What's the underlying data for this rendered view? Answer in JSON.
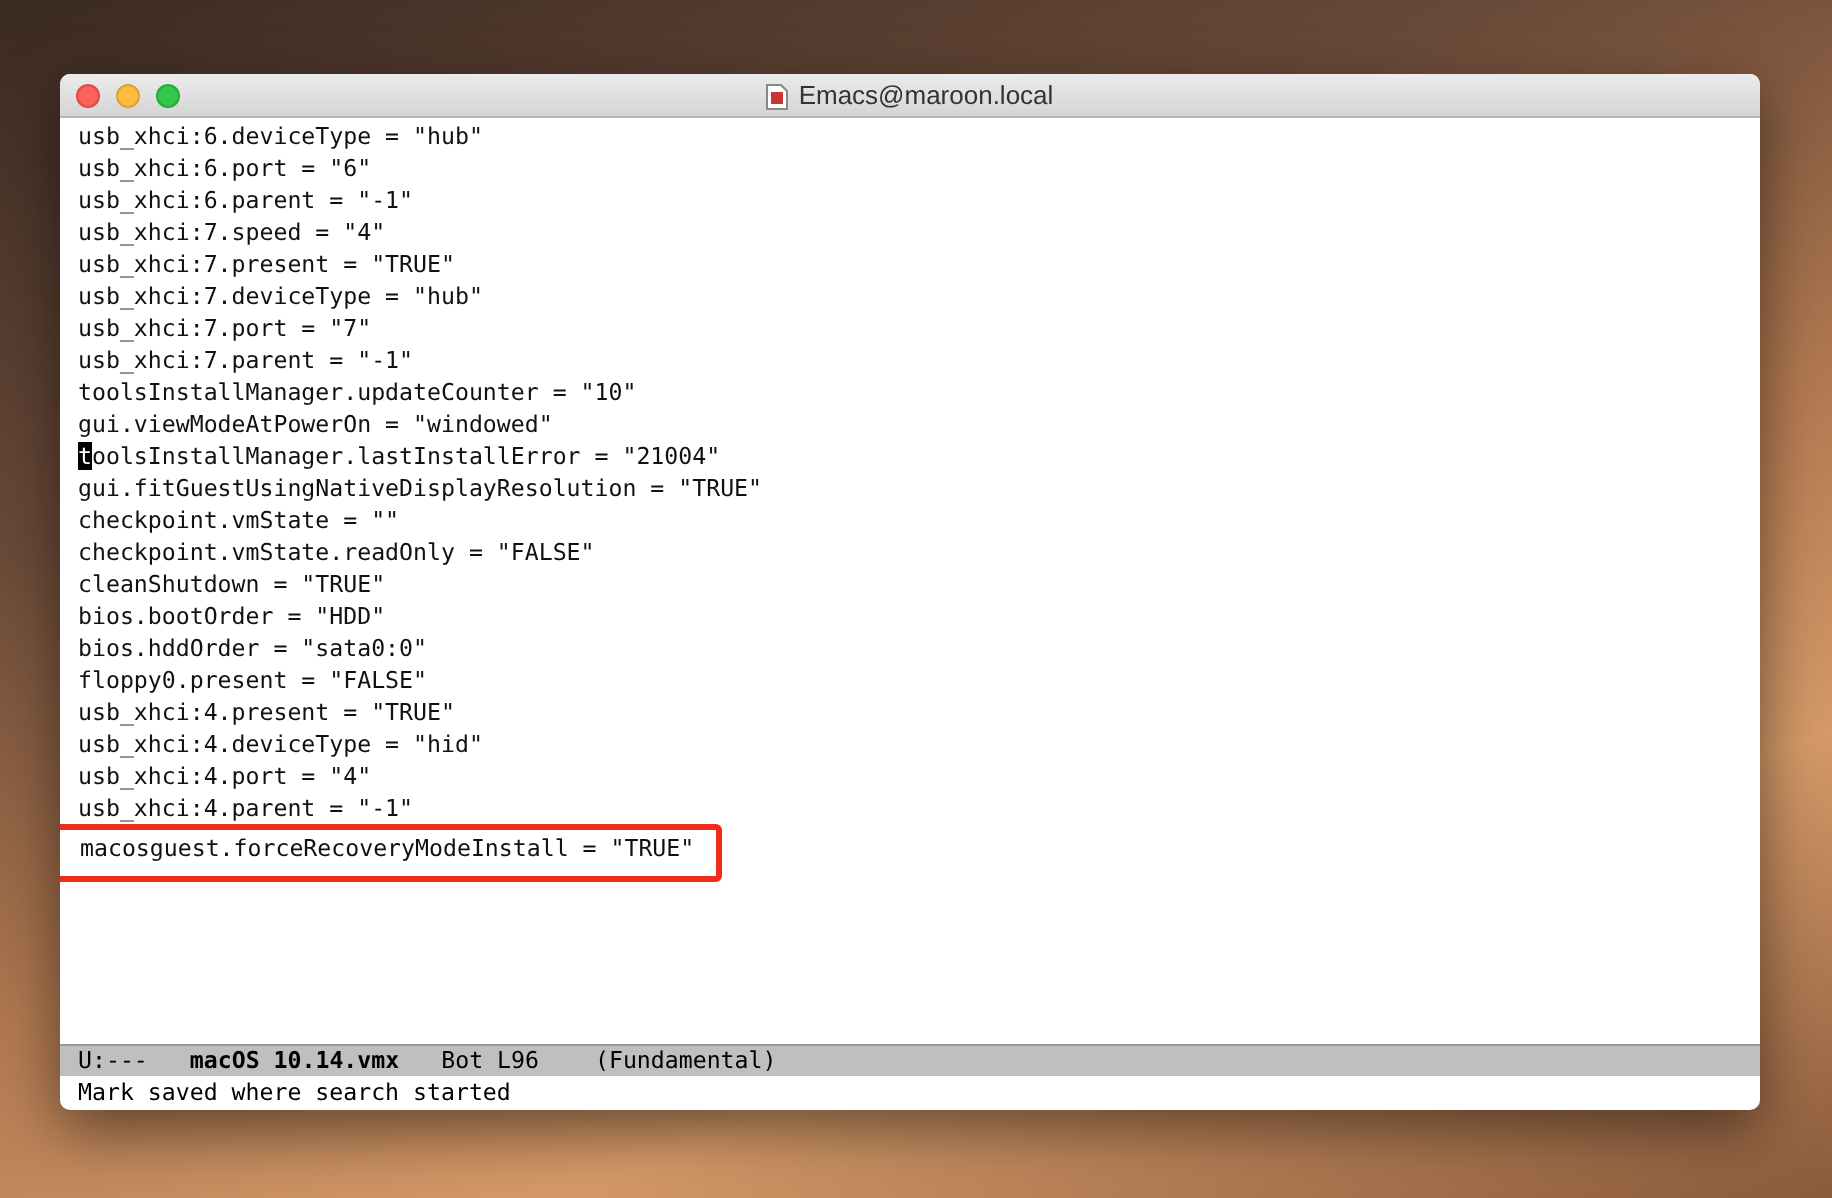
{
  "window": {
    "title": "Emacs@maroon.local"
  },
  "buffer": {
    "lines": [
      {
        "text": "usb_xhci:6.deviceType = \"hub\"",
        "cursor": false,
        "highlighted": false
      },
      {
        "text": "usb_xhci:6.port = \"6\"",
        "cursor": false,
        "highlighted": false
      },
      {
        "text": "usb_xhci:6.parent = \"-1\"",
        "cursor": false,
        "highlighted": false
      },
      {
        "text": "usb_xhci:7.speed = \"4\"",
        "cursor": false,
        "highlighted": false
      },
      {
        "text": "usb_xhci:7.present = \"TRUE\"",
        "cursor": false,
        "highlighted": false
      },
      {
        "text": "usb_xhci:7.deviceType = \"hub\"",
        "cursor": false,
        "highlighted": false
      },
      {
        "text": "usb_xhci:7.port = \"7\"",
        "cursor": false,
        "highlighted": false
      },
      {
        "text": "usb_xhci:7.parent = \"-1\"",
        "cursor": false,
        "highlighted": false
      },
      {
        "text": "toolsInstallManager.updateCounter = \"10\"",
        "cursor": false,
        "highlighted": false
      },
      {
        "text": "gui.viewModeAtPowerOn = \"windowed\"",
        "cursor": false,
        "highlighted": false
      },
      {
        "text": "toolsInstallManager.lastInstallError = \"21004\"",
        "cursor": true,
        "highlighted": false
      },
      {
        "text": "gui.fitGuestUsingNativeDisplayResolution = \"TRUE\"",
        "cursor": false,
        "highlighted": false
      },
      {
        "text": "checkpoint.vmState = \"\"",
        "cursor": false,
        "highlighted": false
      },
      {
        "text": "checkpoint.vmState.readOnly = \"FALSE\"",
        "cursor": false,
        "highlighted": false
      },
      {
        "text": "cleanShutdown = \"TRUE\"",
        "cursor": false,
        "highlighted": false
      },
      {
        "text": "bios.bootOrder = \"HDD\"",
        "cursor": false,
        "highlighted": false
      },
      {
        "text": "bios.hddOrder = \"sata0:0\"",
        "cursor": false,
        "highlighted": false
      },
      {
        "text": "floppy0.present = \"FALSE\"",
        "cursor": false,
        "highlighted": false
      },
      {
        "text": "usb_xhci:4.present = \"TRUE\"",
        "cursor": false,
        "highlighted": false
      },
      {
        "text": "usb_xhci:4.deviceType = \"hid\"",
        "cursor": false,
        "highlighted": false
      },
      {
        "text": "usb_xhci:4.port = \"4\"",
        "cursor": false,
        "highlighted": false
      },
      {
        "text": "usb_xhci:4.parent = \"-1\"",
        "cursor": false,
        "highlighted": false
      },
      {
        "text": "macosguest.forceRecoveryModeInstall = \"TRUE\"",
        "cursor": false,
        "highlighted": true
      }
    ]
  },
  "mode_line": {
    "status": "U:---",
    "buffer_name": "macOS 10.14.vmx",
    "position": "Bot L96",
    "mode": "(Fundamental)"
  },
  "echo_area": "Mark saved where search started"
}
